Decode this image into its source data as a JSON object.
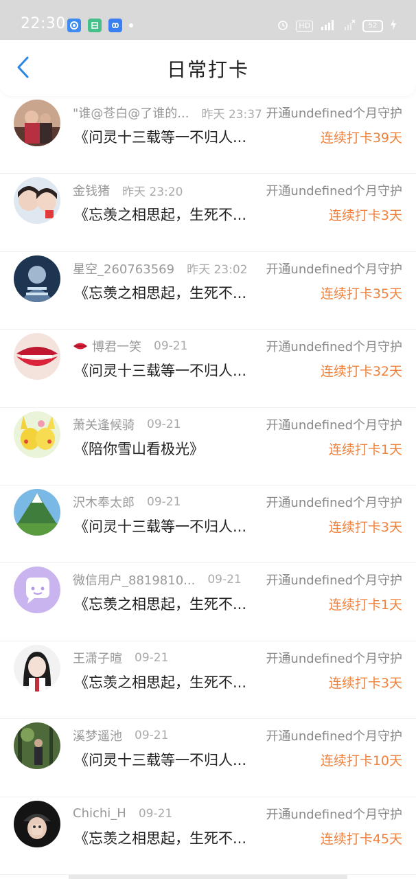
{
  "status_bar": {
    "time": "22:30",
    "battery": "52",
    "indicators": [
      "alarm-icon",
      "hd-icon",
      "4g-signal-icon",
      "wifi-off-icon",
      "battery-icon",
      "charging-icon"
    ]
  },
  "nav": {
    "title": "日常打卡",
    "back_icon": "chevron-left-icon"
  },
  "colors": {
    "accent": "#2b86e3",
    "streak": "#f0803a",
    "secondary_text": "#999999"
  },
  "checkins": [
    {
      "name": "\"谁@苍白@了谁的...",
      "time": "昨天 23:37",
      "guard": "开通undefined个月守护",
      "book": "《问灵十三载等一不归人...",
      "streak": "连续打卡39天"
    },
    {
      "name": "金钱猪",
      "time": "昨天 23:20",
      "guard": "开通undefined个月守护",
      "book": "《忘羡之相思起，生死不...",
      "streak": "连续打卡3天"
    },
    {
      "name": "星空_260763569",
      "time": "昨天 23:02",
      "guard": "开通undefined个月守护",
      "book": "《忘羡之相思起，生死不...",
      "streak": "连续打卡35天"
    },
    {
      "name": "博君一笑",
      "time": "09-21",
      "guard": "开通undefined个月守护",
      "book": "《问灵十三载等一不归人...",
      "streak": "连续打卡32天"
    },
    {
      "name": "萧关逢候骑",
      "time": "09-21",
      "guard": "开通undefined个月守护",
      "book": "《陪你雪山看极光》",
      "streak": "连续打卡1天"
    },
    {
      "name": "沢木奉太郎",
      "time": "09-21",
      "guard": "开通undefined个月守护",
      "book": "《问灵十三载等一不归人...",
      "streak": "连续打卡3天"
    },
    {
      "name": "微信用户_8819810...",
      "time": "09-21",
      "guard": "开通undefined个月守护",
      "book": "《忘羡之相思起，生死不...",
      "streak": "连续打卡1天"
    },
    {
      "name": "王潇子暄",
      "time": "09-21",
      "guard": "开通undefined个月守护",
      "book": "《忘羡之相思起，生死不...",
      "streak": "连续打卡3天"
    },
    {
      "name": "溪梦遥池",
      "time": "09-21",
      "guard": "开通undefined个月守护",
      "book": "《问灵十三载等一不归人...",
      "streak": "连续打卡10天"
    },
    {
      "name": "Chichi_H",
      "time": "09-21",
      "guard": "开通undefined个月守护",
      "book": "《忘羡之相思起，生死不...",
      "streak": "连续打卡45天"
    }
  ]
}
